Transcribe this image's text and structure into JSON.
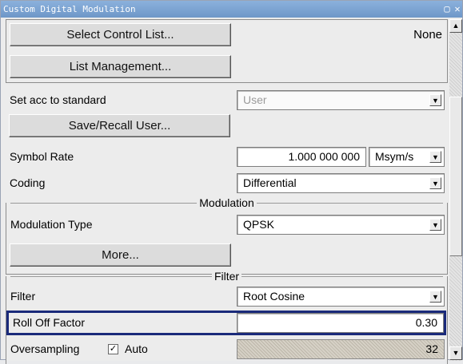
{
  "window": {
    "title": "Custom Digital Modulation"
  },
  "list": {
    "select_label": "Select Control List...",
    "selected_value": "None",
    "manage_label": "List Management..."
  },
  "standard": {
    "label": "Set acc to standard",
    "value": "User",
    "save_recall_label": "Save/Recall User..."
  },
  "symbol_rate": {
    "label": "Symbol Rate",
    "value": "1.000 000 000",
    "unit": "Msym/s"
  },
  "coding": {
    "label": "Coding",
    "value": "Differential"
  },
  "modulation": {
    "section_title": "Modulation",
    "type_label": "Modulation Type",
    "type_value": "QPSK",
    "more_label": "More..."
  },
  "filter": {
    "section_title": "Filter",
    "label": "Filter",
    "value": "Root Cosine",
    "roll_off_label": "Roll Off Factor",
    "roll_off_value": "0.30"
  },
  "oversampling": {
    "label": "Oversampling",
    "auto_label": "Auto",
    "auto_checked": true,
    "value": "32"
  },
  "colors": {
    "titlebar": "#7ea6d6",
    "highlight": "#1a2a7a"
  }
}
